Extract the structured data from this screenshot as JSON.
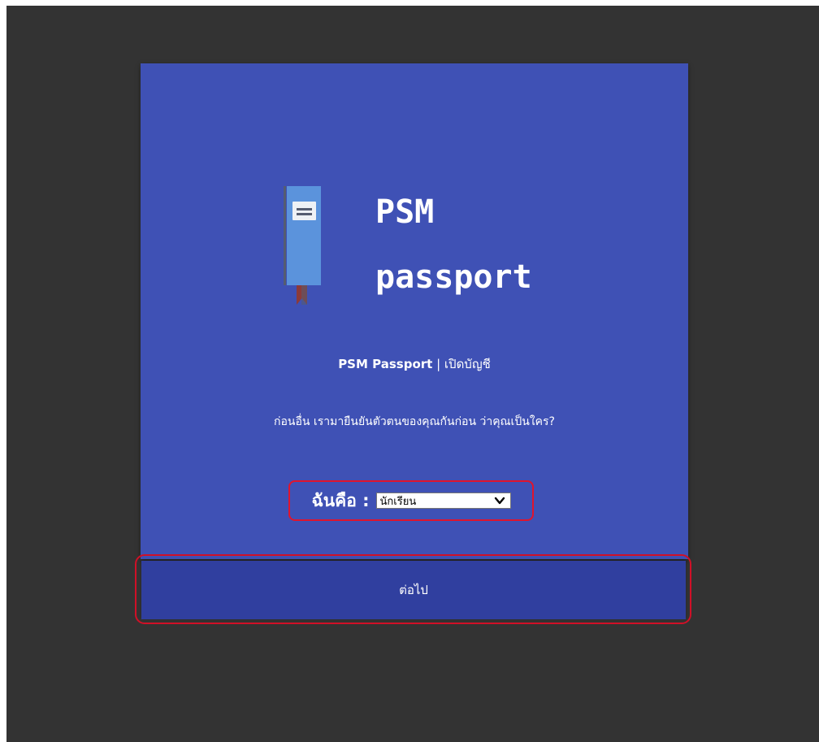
{
  "logo": {
    "line1": "PSM",
    "line2": "passport"
  },
  "header": {
    "app_name": "PSM Passport",
    "separator": " | ",
    "page_name": "เปิดบัญชี"
  },
  "intro": {
    "text": "ก่อนอื่น เรามายืนยันตัวตนของคุณกันก่อน ว่าคุณเป็นใคร?"
  },
  "role_select": {
    "label": "ฉันคือ :",
    "selected": "นักเรียน"
  },
  "actions": {
    "next_label": "ต่อไป"
  },
  "colors": {
    "background": "#333333",
    "card": "#3f51b5",
    "button": "#303f9f",
    "highlight": "#d01027",
    "book_cover": "#5b93dc",
    "book_bookmark": "#8b3a3a"
  },
  "icons": {
    "logo": "book-icon",
    "dropdown": "chevron-down-icon"
  }
}
